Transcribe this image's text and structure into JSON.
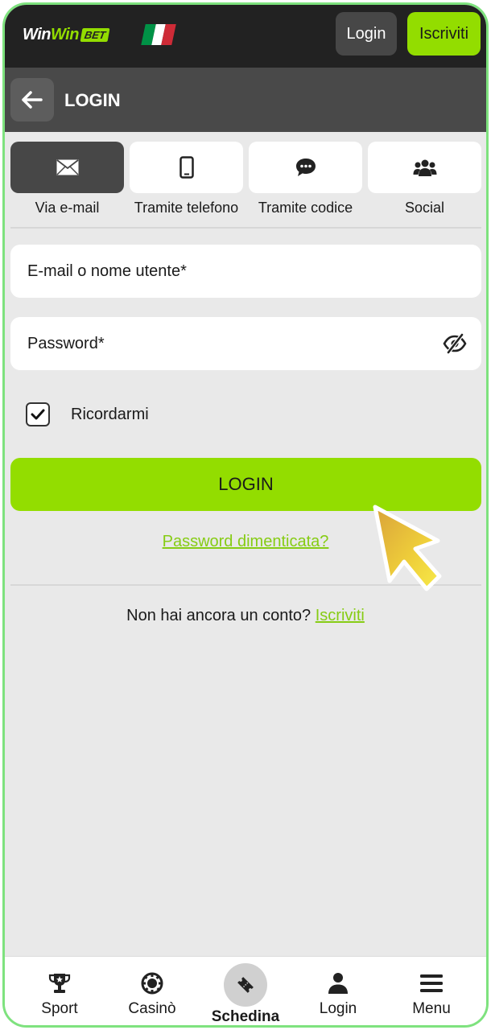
{
  "header": {
    "logo": {
      "part1": "Win",
      "part2": "Win",
      "badge": "BET"
    },
    "flag_colors": [
      "#009246",
      "#ffffff",
      "#ce2b37"
    ],
    "login_label": "Login",
    "register_label": "Iscriviti"
  },
  "subheader": {
    "back_icon": "arrow-left-icon",
    "title": "LOGIN"
  },
  "tabs": [
    {
      "icon": "envelope-icon",
      "label": "Via e-mail",
      "active": true
    },
    {
      "icon": "phone-icon",
      "label": "Tramite telefono",
      "active": false
    },
    {
      "icon": "chat-icon",
      "label": "Tramite codice",
      "active": false
    },
    {
      "icon": "users-icon",
      "label": "Social",
      "active": false
    }
  ],
  "form": {
    "email_placeholder": "E-mail o nome utente*",
    "password_placeholder": "Password*",
    "remember_label": "Ricordarmi",
    "remember_checked": true,
    "submit_label": "LOGIN",
    "forgot_label": "Password dimenticata?",
    "no_account_text": "Non hai ancora un conto?",
    "signup_link": "Iscriviti"
  },
  "bottom_nav": [
    {
      "icon": "trophy-icon",
      "label": "Sport"
    },
    {
      "icon": "casino-chip-icon",
      "label": "Casinò"
    },
    {
      "icon": "ticket-icon",
      "label": "Schedina"
    },
    {
      "icon": "user-icon",
      "label": "Login"
    },
    {
      "icon": "hamburger-menu-icon",
      "label": "Menu"
    }
  ],
  "colors": {
    "accent": "#93dd00",
    "link": "#86cc14",
    "dark": "#222222",
    "subheader": "#494949",
    "background": "#e9e9e9",
    "frame": "#7ee27e"
  }
}
